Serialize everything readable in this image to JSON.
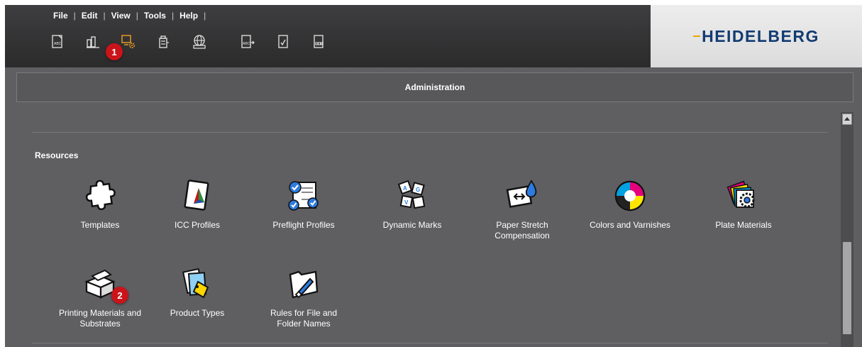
{
  "menu": [
    "File",
    "Edit",
    "View",
    "Tools",
    "Help"
  ],
  "toolbar": {
    "tools": [
      {
        "icon": "document-abc-icon"
      },
      {
        "icon": "bars-chart-icon"
      },
      {
        "icon": "monitor-gear-icon",
        "active": true
      },
      {
        "icon": "device-icon"
      },
      {
        "icon": "globe-monitor-icon"
      },
      {
        "icon": "document-abc-arrow-icon"
      },
      {
        "icon": "document-check-icon"
      },
      {
        "icon": "document-ddd-icon"
      }
    ],
    "callout_1": "1"
  },
  "brand": {
    "logo": "HEIDELBERG",
    "color": "#123b73",
    "accent": "#e8a800"
  },
  "panel": {
    "title": "Administration"
  },
  "resources": {
    "section_title": "Resources",
    "items": [
      {
        "label": "Templates",
        "icon": "puzzle-icon"
      },
      {
        "label": "ICC Profiles",
        "icon": "color-gamut-icon"
      },
      {
        "label": "Preflight Profiles",
        "icon": "checklist-icon"
      },
      {
        "label": "Dynamic Marks",
        "icon": "tiles-icon"
      },
      {
        "label": "Paper Stretch Compensation",
        "icon": "stretch-drop-icon"
      },
      {
        "label": "Colors and Varnishes",
        "icon": "cmyk-circle-icon"
      },
      {
        "label": "Plate Materials",
        "icon": "plates-gear-icon"
      },
      {
        "label": "Printing Materials and Substrates",
        "icon": "substrate-box-icon"
      },
      {
        "label": "Product Types",
        "icon": "tag-icon"
      },
      {
        "label": "Rules for File and Folder Names",
        "icon": "folder-brush-icon"
      }
    ],
    "callout_2": "2"
  },
  "colors": {
    "callout": "#c9141a",
    "background": "#5f5f62"
  }
}
